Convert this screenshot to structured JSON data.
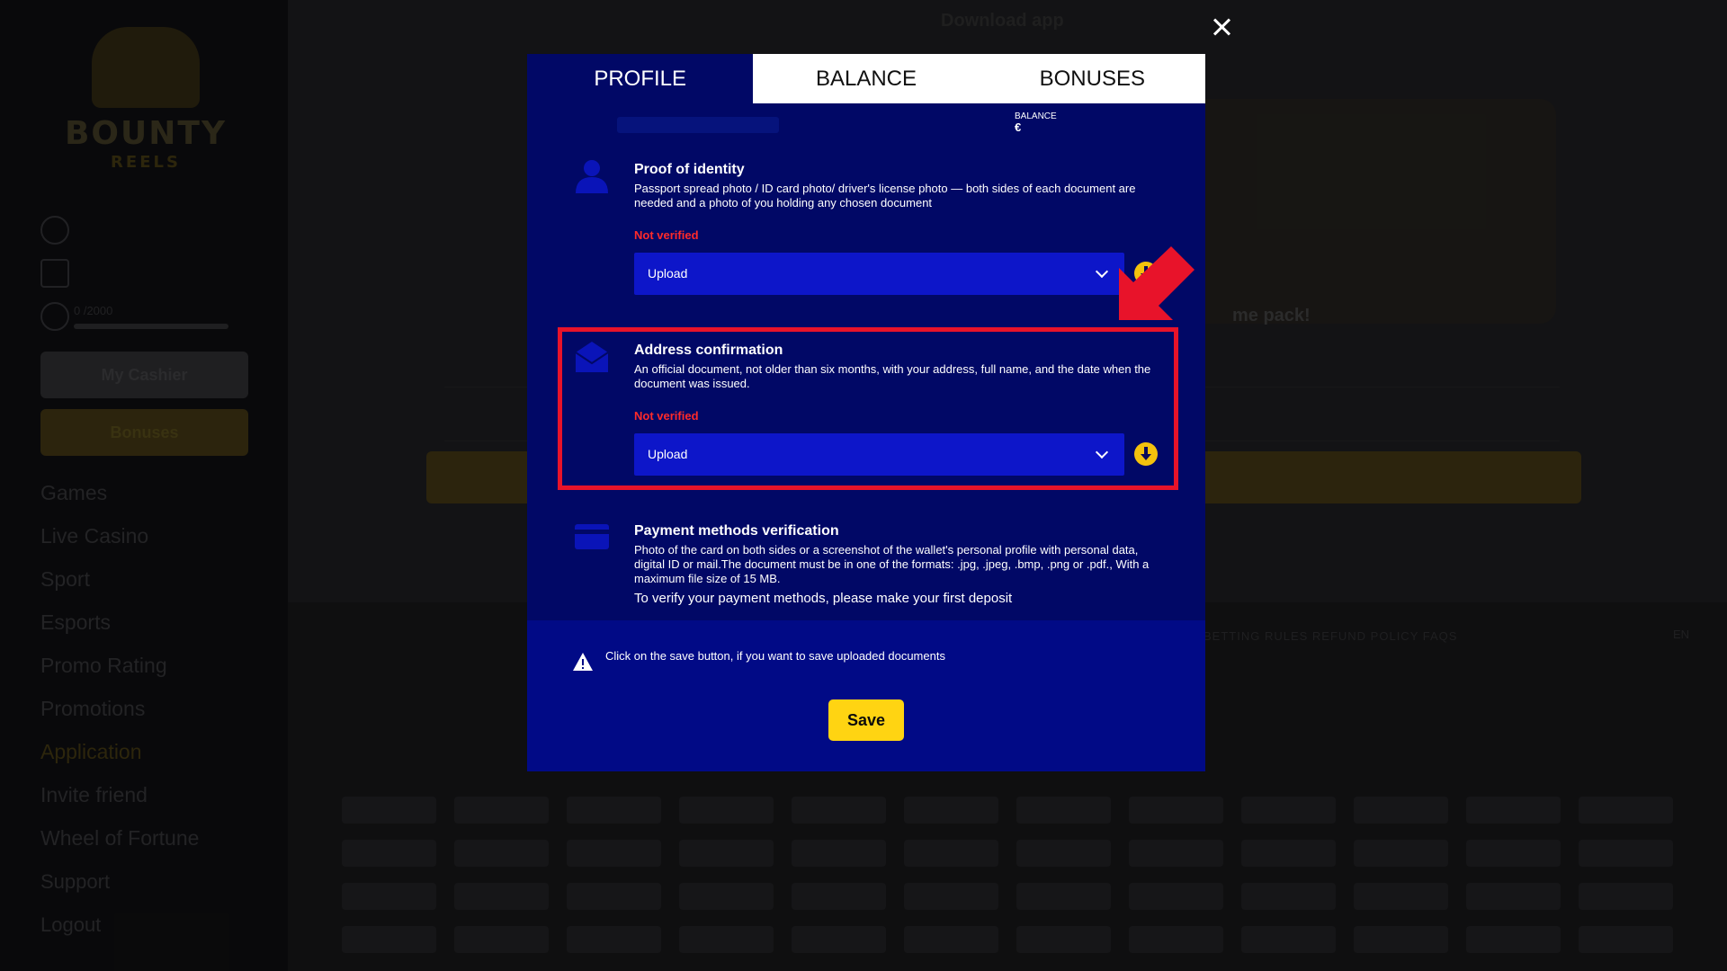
{
  "site": {
    "logo_line1": "BOUNTY",
    "logo_line2": "REELS",
    "progress_label": "0 /2000",
    "cashier_label": "My Cashier",
    "bonuses_label": "Bonuses",
    "nav": [
      "Games",
      "Live Casino",
      "Sport",
      "Esports",
      "Promo Rating",
      "Promotions",
      "Application",
      "Invite friend",
      "Wheel of Fortune"
    ],
    "support_label": "Support",
    "logout_label": "Logout",
    "download_title": "Download app",
    "banner_text": "me pack!",
    "footer_links": "BETTING RULES     REFUND POLICY     FAQS",
    "language": "EN"
  },
  "modal": {
    "tabs": [
      {
        "label": "PROFILE"
      },
      {
        "label": "BALANCE"
      },
      {
        "label": "BONUSES"
      }
    ],
    "balance_label": "BALANCE",
    "balance_currency": "€",
    "documents": [
      {
        "title": "Proof of identity",
        "description": "Passport spread photo / ID card photo/ driver's license photo — both sides of each document are needed and a photo of you holding any chosen document",
        "status": "Not verified",
        "upload_label": "Upload",
        "icon": "person-icon"
      },
      {
        "title": "Address confirmation",
        "description": "An official document, not older than six months, with your address, full name, and the date when the document was issued.",
        "status": "Not verified",
        "upload_label": "Upload",
        "icon": "envelope-icon"
      },
      {
        "title": "Payment methods verification",
        "description": "Photo of the card on both sides or a screenshot of the wallet's personal profile with personal data, digital ID or mail.The document must be in one of the formats: .jpg, .jpeg, .bmp, .png or .pdf., With a maximum file size of 15 MB.",
        "note": "To verify your payment methods, please make your first deposit",
        "icon": "card-icon"
      }
    ],
    "save_note": "Click on the save button, if you want to save uploaded documents",
    "save_label": "Save"
  },
  "colors": {
    "modal_bg": "#010866",
    "upload_bg": "#0d16c9",
    "accent": "#ffd412",
    "status_red": "#ff2a2a",
    "highlight": "#e8132a"
  }
}
